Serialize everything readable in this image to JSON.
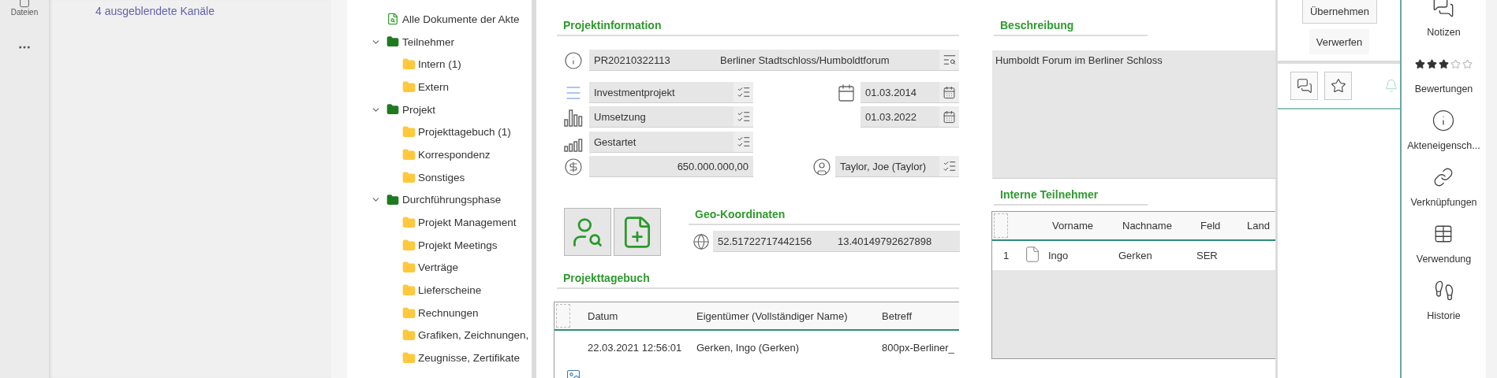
{
  "app_rail": {
    "items": [
      {
        "label": "Dateien"
      }
    ]
  },
  "channels": {
    "hidden_link": "4 ausgeblendete Kanäle"
  },
  "tree": [
    {
      "label": "Alle Dokumente der Akte",
      "kind": "document"
    },
    {
      "label": "Teilnehmer",
      "kind": "group",
      "expanded": true,
      "children": [
        {
          "label": "Intern (1)",
          "kind": "folder"
        },
        {
          "label": "Extern",
          "kind": "folder"
        }
      ]
    },
    {
      "label": "Projekt",
      "kind": "group",
      "expanded": true,
      "children": [
        {
          "label": "Projekttagebuch (1)",
          "kind": "folder"
        },
        {
          "label": "Korrespondenz",
          "kind": "folder"
        },
        {
          "label": "Sonstiges",
          "kind": "folder"
        }
      ]
    },
    {
      "label": "Durchführungsphase",
      "kind": "group",
      "expanded": true,
      "children": [
        {
          "label": "Projekt Management",
          "kind": "folder"
        },
        {
          "label": "Projekt Meetings",
          "kind": "folder"
        },
        {
          "label": "Verträge",
          "kind": "folder"
        },
        {
          "label": "Lieferscheine",
          "kind": "folder"
        },
        {
          "label": "Rechnungen",
          "kind": "folder"
        },
        {
          "label": "Grafiken, Zeichnungen,",
          "kind": "folder"
        },
        {
          "label": "Zeugnisse, Zertifikate",
          "kind": "folder"
        }
      ]
    }
  ],
  "project_info": {
    "title": "Projektinformation",
    "number": "PR20210322113",
    "name": "Berliner Stadtschloss/Humboldtforum",
    "type": "Investmentprojekt",
    "phase": "Umsetzung",
    "status": "Gestartet",
    "budget": "650.000.000,00",
    "start_date": "01.03.2014",
    "end_date": "01.03.2022",
    "owner": "Taylor, Joe (Taylor)"
  },
  "geo": {
    "title": "Geo-Koordinaten",
    "latitude": "52.51722717442156",
    "longitude": "13.40149792627898"
  },
  "diary": {
    "title": "Projekttagebuch",
    "select_all": {
      "checked": false
    },
    "columns": [
      "Datum",
      "Eigentümer (Vollständiger Name)",
      "Betreff"
    ],
    "rows": [
      {
        "cells": [
          "22.03.2021 12:56:01",
          "Gerken, Ingo (Gerken)",
          "800px-Berliner_"
        ]
      }
    ]
  },
  "description": {
    "title": "Beschreibung",
    "text": "Humboldt Forum im Berliner Schloss"
  },
  "participants": {
    "title": "Interne Teilnehmer",
    "select_all": {
      "checked": false
    },
    "columns": [
      "Vorname",
      "Nachname",
      "Feld",
      "Land"
    ],
    "rows": [
      {
        "index": "1",
        "cells": [
          "Ingo",
          "Gerken",
          "SER"
        ]
      }
    ]
  },
  "actions": {
    "apply": "Übernehmen",
    "discard": "Verwerfen"
  },
  "side_nav": [
    {
      "label": "Notizen",
      "kind": "notes"
    },
    {
      "label": "Bewertungen",
      "kind": "rating",
      "stars": 3
    },
    {
      "label": "Akteneigensch...",
      "kind": "properties"
    },
    {
      "label": "Verknüpfungen",
      "kind": "links"
    },
    {
      "label": "Verwendung",
      "kind": "usage"
    },
    {
      "label": "Historie",
      "kind": "history"
    }
  ]
}
